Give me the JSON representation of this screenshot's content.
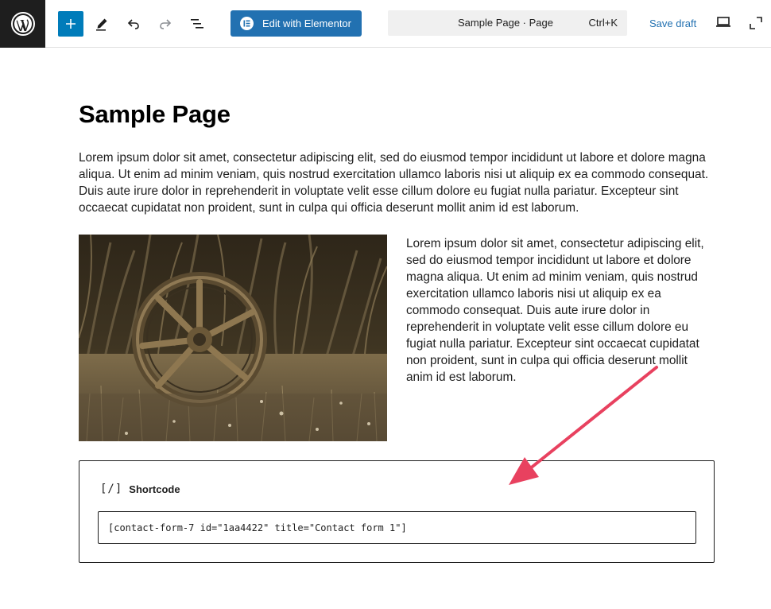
{
  "toolbar": {
    "wp_logo_icon": "wordpress-logo-icon",
    "add_block_icon": "plus-icon",
    "tools_icon": "pencil-icon",
    "undo_icon": "undo-icon",
    "redo_icon": "redo-icon",
    "outline_icon": "document-outline-icon",
    "elementor_label": "Edit with Elementor",
    "command_title": "Sample Page · Page",
    "command_shortcut": "Ctrl+K",
    "save_draft_label": "Save draft",
    "view_icon": "laptop-icon",
    "fullscreen_icon": "fullscreen-icon",
    "accent_color": "#2271b1"
  },
  "content": {
    "title": "Sample Page",
    "paragraph_1": "Lorem ipsum dolor sit amet, consectetur adipiscing elit, sed do eiusmod tempor incididunt ut labore et dolore magna aliqua. Ut enim ad minim veniam, quis nostrud exercitation ullamco laboris nisi ut aliquip ex ea commodo consequat. Duis aute irure dolor in reprehenderit in voluptate velit esse cillum dolore eu fugiat nulla pariatur. Excepteur sint occaecat cupidatat non proident, sunt in culpa qui officia deserunt mollit anim id est laborum.",
    "paragraph_2": "Lorem ipsum dolor sit amet, consectetur adipiscing elit, sed do eiusmod tempor incididunt ut labore et dolore magna aliqua. Ut enim ad minim veniam, quis nostrud exercitation ullamco laboris nisi ut aliquip ex ea commodo consequat. Duis aute irure dolor in reprehenderit in voluptate velit esse cillum dolore eu fugiat nulla pariatur. Excepteur sint occaecat cupidatat non proident, sunt in culpa qui officia deserunt mollit anim id est laborum.",
    "image_subject": "sepia-wagon-wheel-in-grass"
  },
  "shortcode": {
    "icon_glyph": "[/]",
    "label": "Shortcode",
    "value": "[contact-form-7 id=\"1aa4422\" title=\"Contact form 1\"]"
  },
  "annotation": {
    "arrow_color": "#e8415f"
  }
}
